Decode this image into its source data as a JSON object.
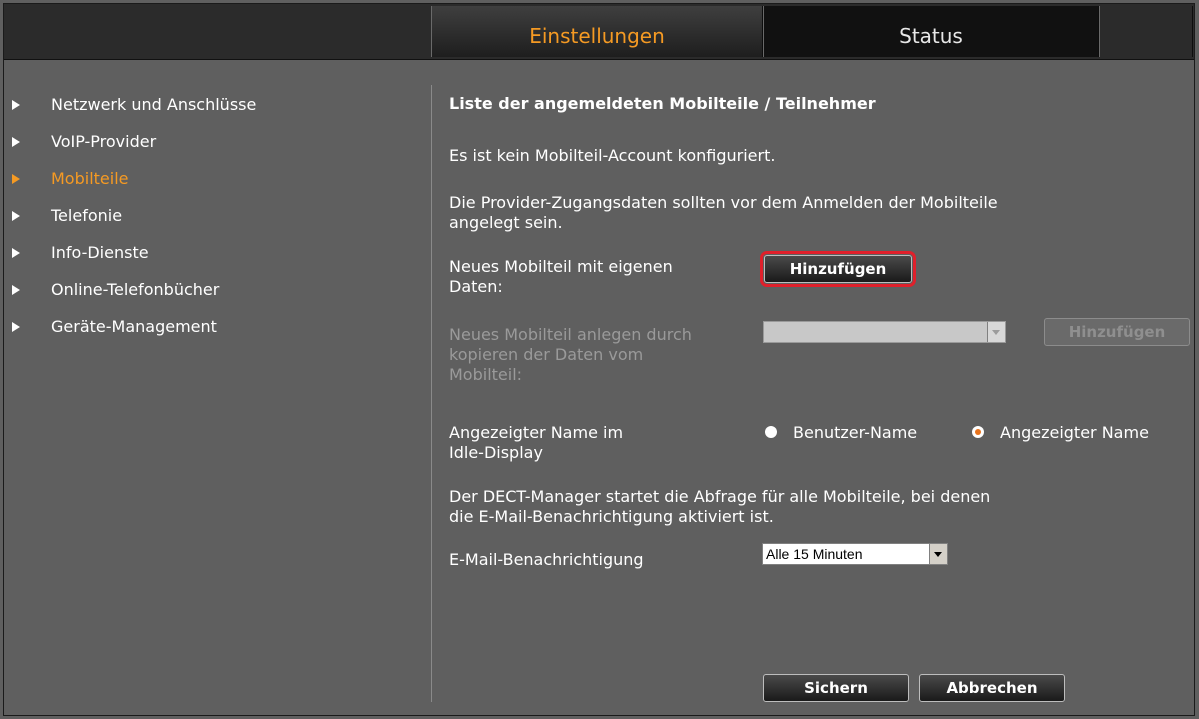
{
  "tabs": {
    "settings": "Einstellungen",
    "status": "Status"
  },
  "nav": {
    "items": [
      {
        "label": "Netzwerk und Anschlüsse",
        "active": false
      },
      {
        "label": "VoIP-Provider",
        "active": false
      },
      {
        "label": "Mobilteile",
        "active": true
      },
      {
        "label": "Telefonie",
        "active": false
      },
      {
        "label": "Info-Dienste",
        "active": false
      },
      {
        "label": "Online-Telefonbücher",
        "active": false
      },
      {
        "label": "Geräte-Management",
        "active": false
      }
    ]
  },
  "main": {
    "heading": "Liste der angemeldeten Mobilteile / Teilnehmer",
    "no_account": "Es ist kein Mobilteil-Account konfiguriert.",
    "provider_note_line1": "Die Provider-Zugangsdaten sollten vor dem Anmelden der Mobilteile",
    "provider_note_line2": "angelegt sein.",
    "new_handset_label_line1": "Neues Mobilteil mit eigenen",
    "new_handset_label_line2": "Daten:",
    "add_button": "Hinzufügen",
    "copy_label_line1": "Neues Mobilteil anlegen durch",
    "copy_label_line2": "kopieren der Daten vom",
    "copy_label_line3": "Mobilteil:",
    "copy_select_value": "",
    "copy_add_button": "Hinzufügen",
    "idle_label_line1": "Angezeigter Name im",
    "idle_label_line2": "Idle-Display",
    "radio_username": "Benutzer-Name",
    "radio_displayname": "Angezeigter Name",
    "radio_selected": "displayname",
    "dect_note_line1": "Der DECT-Manager startet die Abfrage für alle Mobilteile, bei denen",
    "dect_note_line2": "die E-Mail-Benachrichtigung aktiviert ist.",
    "email_label": "E-Mail-Benachrichtigung",
    "email_select_value": "Alle 15 Minuten",
    "save_button": "Sichern",
    "cancel_button": "Abbrechen"
  },
  "colors": {
    "accent": "#f59a23",
    "background": "#5f5f5f",
    "highlight": "#e0202b"
  }
}
